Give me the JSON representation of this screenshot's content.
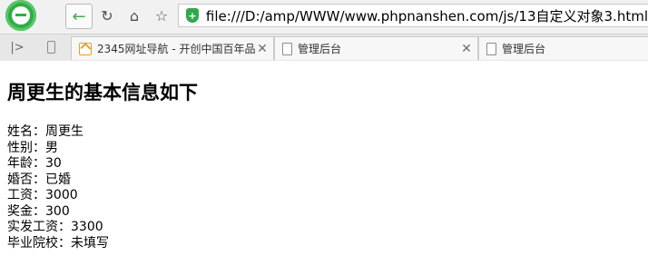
{
  "browser": {
    "address_url": "file:///D:/amp/WWW/www.phpnanshen.com/js/13自定义对象3.html",
    "tabs": [
      {
        "title": "2345网址导航 - 开创中国百年品",
        "icon": "2345-favicon"
      },
      {
        "title": "管理后台",
        "icon": "document-icon"
      },
      {
        "title": "管理后台",
        "icon": "document-icon"
      }
    ]
  },
  "page": {
    "heading": "周更生的基本信息如下",
    "lines": [
      {
        "label": "姓名",
        "value": "周更生"
      },
      {
        "label": "性别",
        "value": "男"
      },
      {
        "label": "年龄",
        "value": "30"
      },
      {
        "label": "婚否",
        "value": "已婚"
      },
      {
        "label": "工资",
        "value": "3000"
      },
      {
        "label": "奖金",
        "value": "300"
      },
      {
        "label": "实发工资",
        "value": "3300"
      },
      {
        "label": "毕业院校",
        "value": "未填写"
      }
    ],
    "separator": "："
  }
}
